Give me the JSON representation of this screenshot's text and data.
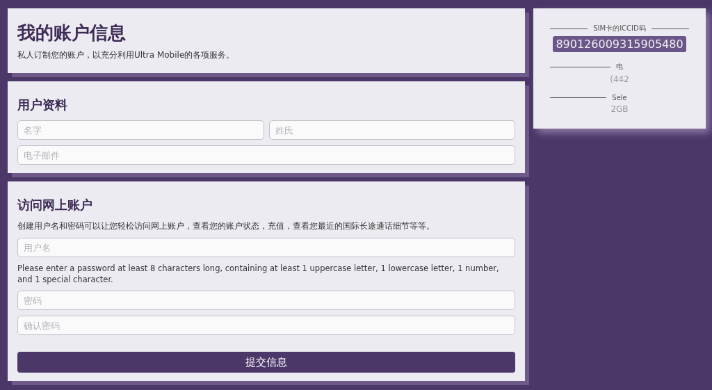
{
  "header": {
    "title": "我的账户信息",
    "subtitle": "私人订制您的账户，以充分利用Ultra Mobile的各项服务。"
  },
  "profile": {
    "title": "用户资料",
    "first_name": {
      "placeholder": "名字"
    },
    "last_name": {
      "placeholder": "姓氏"
    },
    "email": {
      "placeholder": "电子邮件"
    }
  },
  "online_account": {
    "title": "访问网上账户",
    "description": "创建用户名和密码可以让您轻松访问网上账户，查看您的账户状态，充值，查看您最近的国际长途通话细节等等。",
    "username": {
      "placeholder": "用户名"
    },
    "password_hint": "Please enter a password at least 8 characters long, containing at least 1 uppercase letter, 1 lowercase letter, 1 number, and 1 special character.",
    "password": {
      "placeholder": "密码"
    },
    "confirm_password": {
      "placeholder": "确认密码"
    },
    "submit": "提交信息"
  },
  "sidebar": {
    "sections": [
      {
        "label": "SIM卡的ICCID码",
        "value": "890126009315905480",
        "highlighted": true
      },
      {
        "label": "电",
        "value": "(442",
        "highlighted": false
      },
      {
        "label": "Sele",
        "value": "2GB",
        "highlighted": false
      }
    ]
  }
}
